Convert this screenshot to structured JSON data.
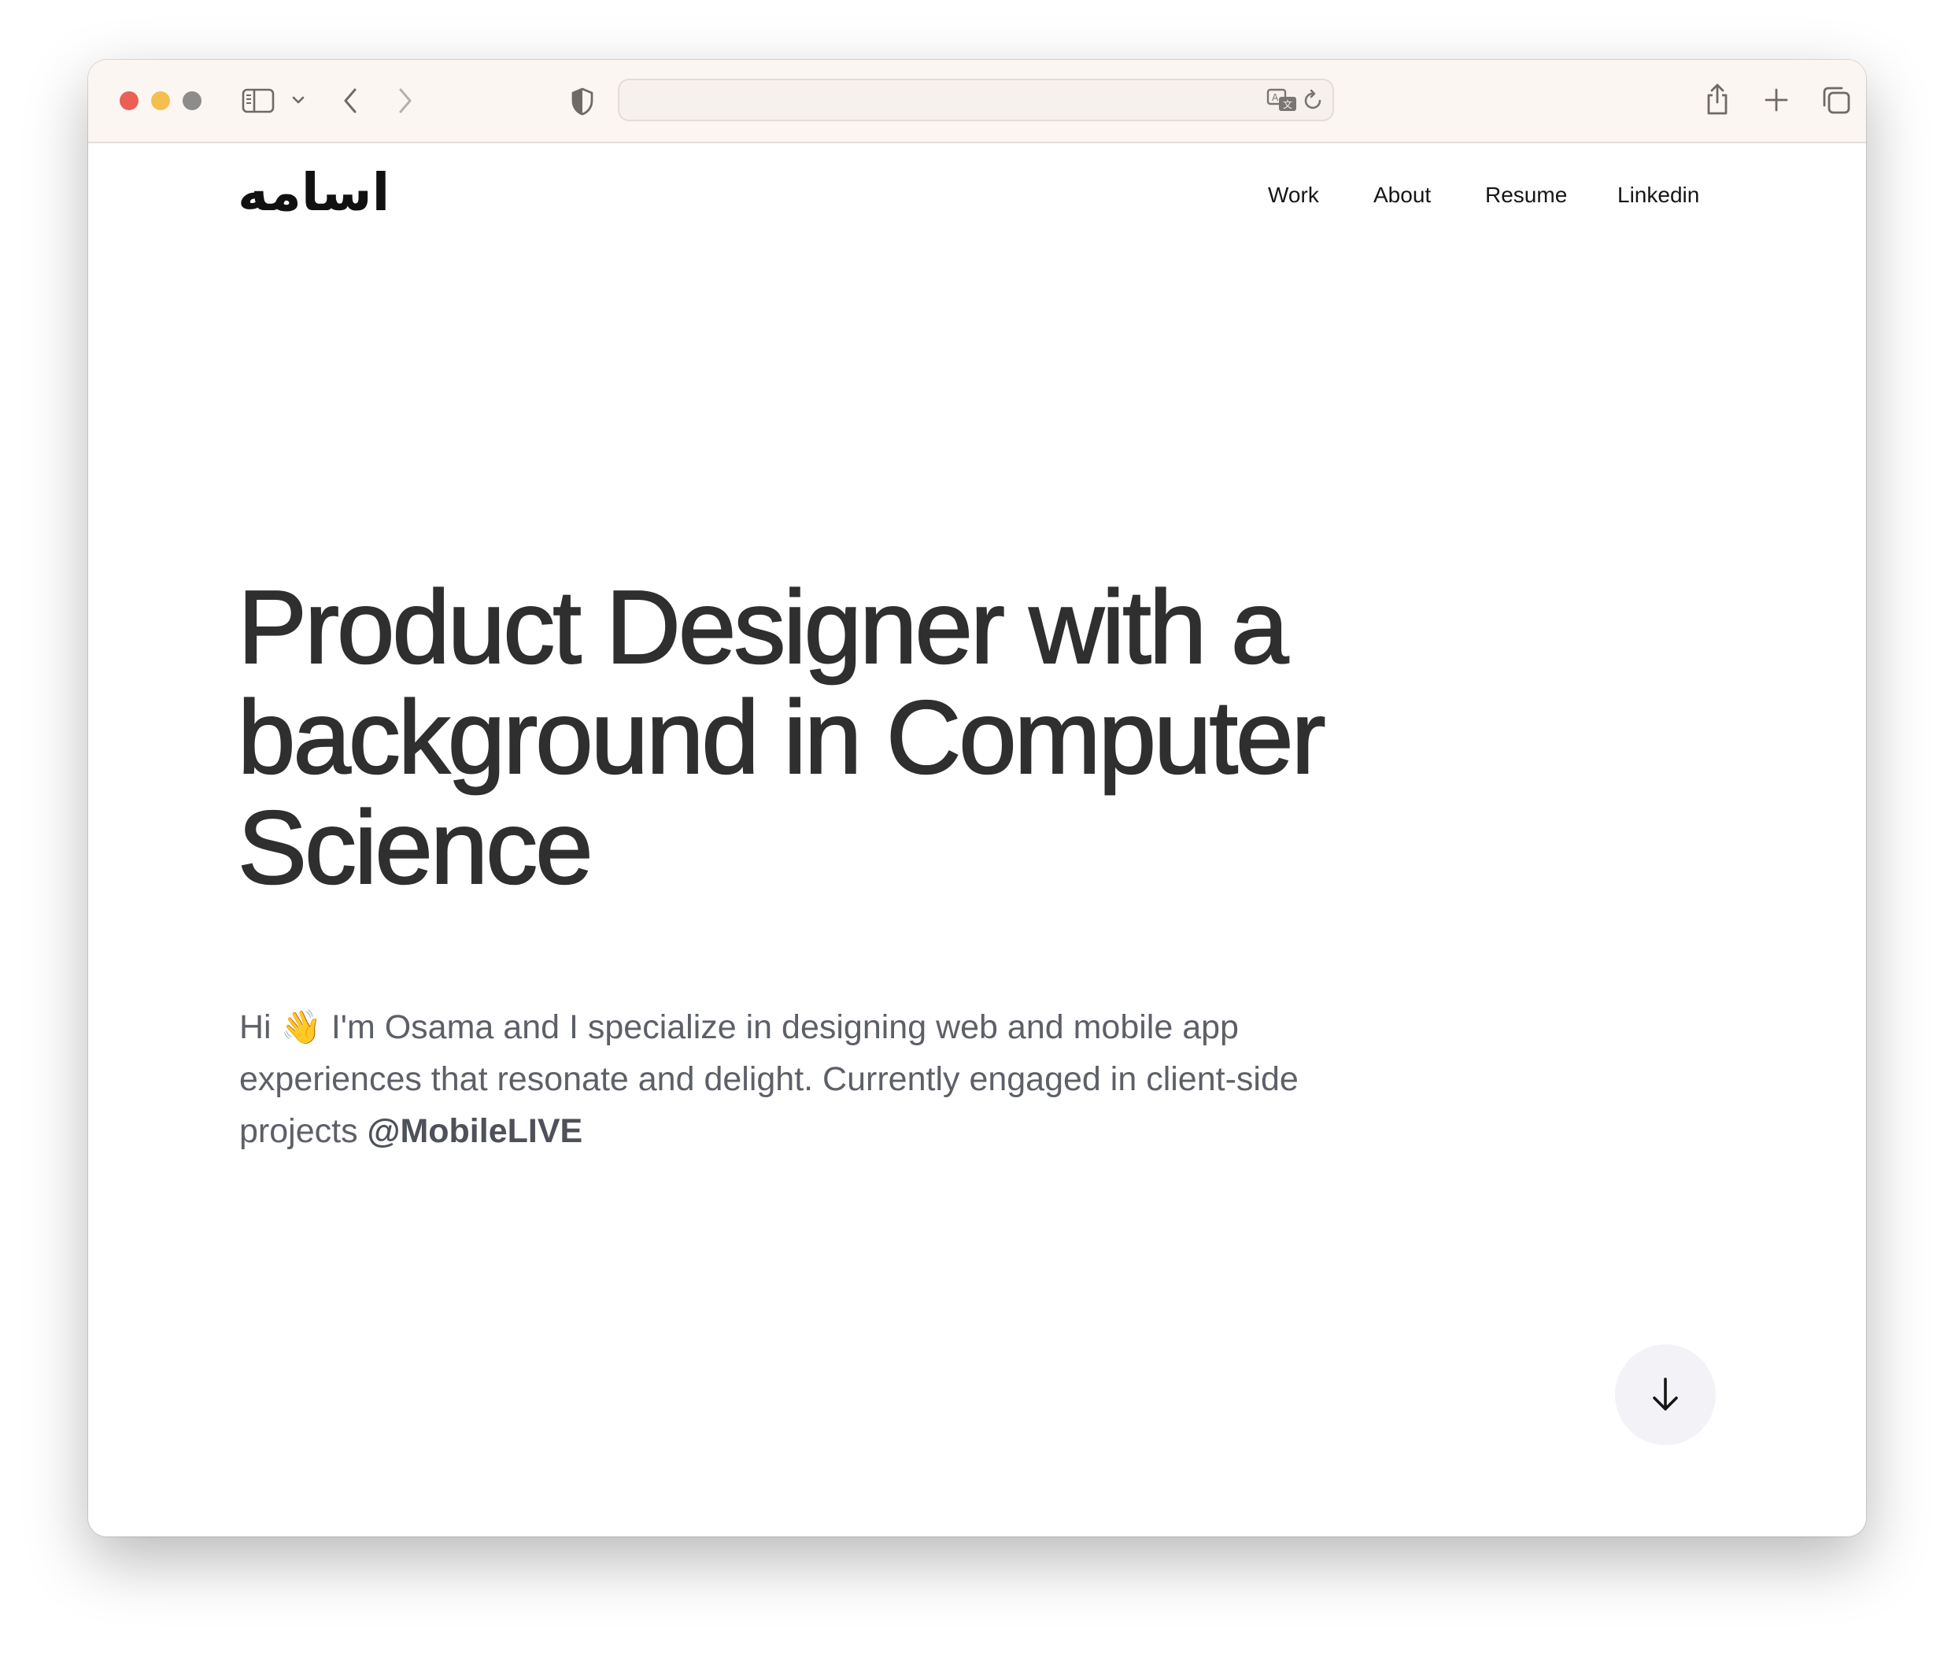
{
  "browser": {
    "url": "",
    "controls": {
      "close_color": "#ec5f56",
      "minimize_color": "#f4bf4f",
      "zoom_color": "#8c8c8c"
    },
    "icons": [
      "sidebar-icon",
      "chevron-down-icon",
      "back-icon",
      "forward-icon",
      "privacy-shield-icon",
      "translate-icon",
      "reload-icon",
      "share-icon",
      "new-tab-icon",
      "tabs-overview-icon"
    ]
  },
  "site": {
    "logo": "اسامه",
    "nav": [
      "Work",
      "About",
      "Resume",
      "Linkedin"
    ]
  },
  "hero": {
    "title": "Product Designer with a background in Computer Science",
    "intro_greeting": "Hi",
    "intro_emoji": "👋",
    "intro_text": "I'm Osama and I specialize in designing web and mobile app experiences that resonate and delight. Currently engaged in client-side projects",
    "intro_handle": "@MobileLIVE"
  },
  "actions": {
    "scroll_down_icon": "arrow-down-icon"
  },
  "colors": {
    "toolbar_bg": "#fcf6f3",
    "title": "#2f2f30",
    "body_text": "#5d6068",
    "scroll_button_bg": "#f3f3f7"
  }
}
